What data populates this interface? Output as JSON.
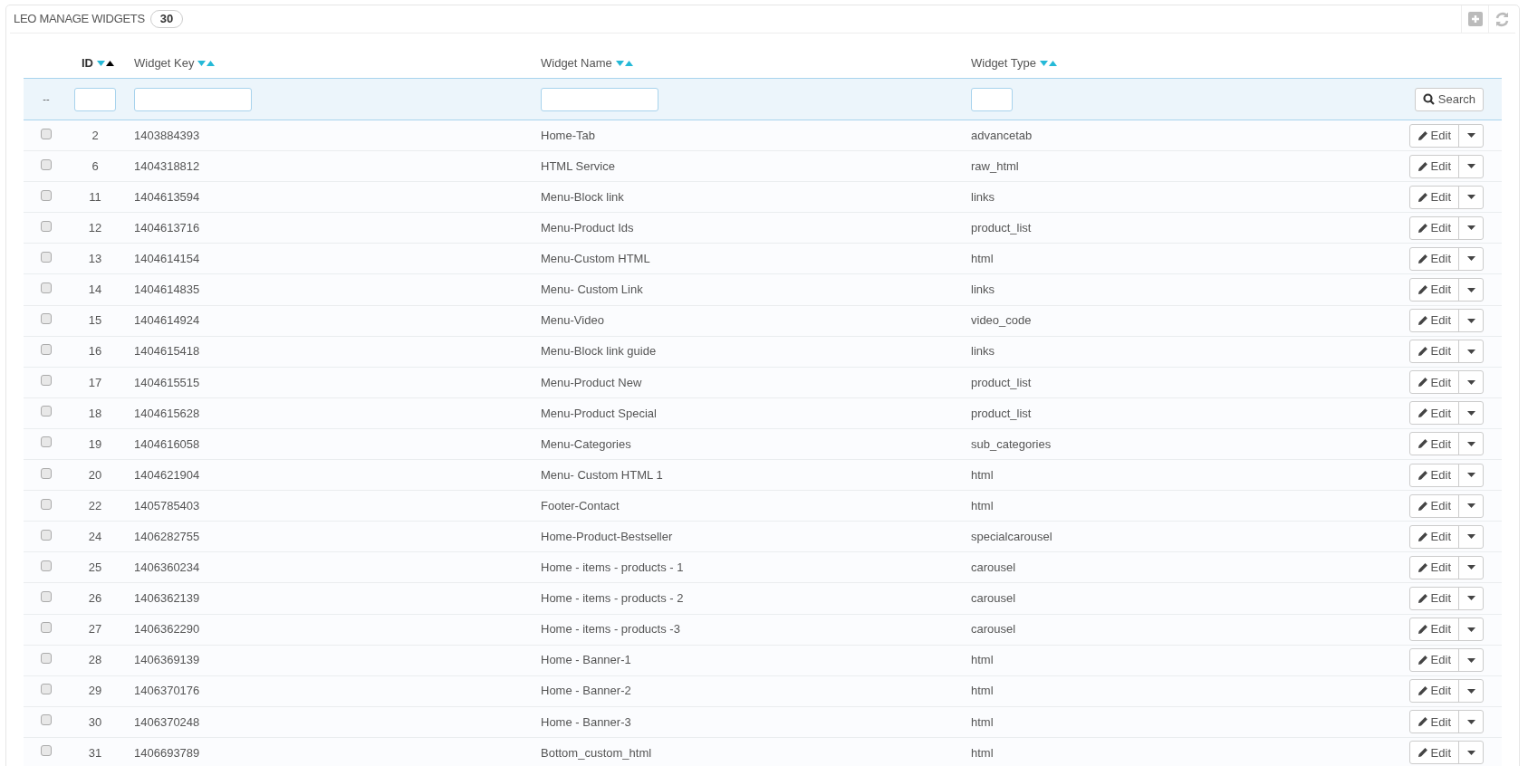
{
  "panel": {
    "title": "LEO MANAGE WIDGETS",
    "count": "30"
  },
  "table": {
    "columns": [
      {
        "label": "ID",
        "sorted_ascending": true
      },
      {
        "label": "Widget Key",
        "sorted_ascending": false
      },
      {
        "label": "Widget Name",
        "sorted_ascending": false
      },
      {
        "label": "Widget Type",
        "sorted_ascending": false
      }
    ],
    "filter_row": {
      "bulk_label": "--",
      "search_button": "Search"
    },
    "rows": [
      {
        "checked": false,
        "id": "2",
        "key": "1403884393",
        "name": "Home-Tab",
        "type": "advancetab",
        "edit": "Edit"
      },
      {
        "checked": false,
        "id": "6",
        "key": "1404318812",
        "name": "HTML Service",
        "type": "raw_html",
        "edit": "Edit"
      },
      {
        "checked": false,
        "id": "11",
        "key": "1404613594",
        "name": "Menu-Block link",
        "type": "links",
        "edit": "Edit"
      },
      {
        "checked": false,
        "id": "12",
        "key": "1404613716",
        "name": "Menu-Product Ids",
        "type": "product_list",
        "edit": "Edit"
      },
      {
        "checked": false,
        "id": "13",
        "key": "1404614154",
        "name": "Menu-Custom HTML",
        "type": "html",
        "edit": "Edit"
      },
      {
        "checked": false,
        "id": "14",
        "key": "1404614835",
        "name": "Menu- Custom Link",
        "type": "links",
        "edit": "Edit"
      },
      {
        "checked": false,
        "id": "15",
        "key": "1404614924",
        "name": "Menu-Video",
        "type": "video_code",
        "edit": "Edit"
      },
      {
        "checked": false,
        "id": "16",
        "key": "1404615418",
        "name": "Menu-Block link guide",
        "type": "links",
        "edit": "Edit"
      },
      {
        "checked": false,
        "id": "17",
        "key": "1404615515",
        "name": "Menu-Product New",
        "type": "product_list",
        "edit": "Edit"
      },
      {
        "checked": false,
        "id": "18",
        "key": "1404615628",
        "name": "Menu-Product Special",
        "type": "product_list",
        "edit": "Edit"
      },
      {
        "checked": false,
        "id": "19",
        "key": "1404616058",
        "name": "Menu-Categories",
        "type": "sub_categories",
        "edit": "Edit"
      },
      {
        "checked": false,
        "id": "20",
        "key": "1404621904",
        "name": "Menu- Custom HTML 1",
        "type": "html",
        "edit": "Edit"
      },
      {
        "checked": false,
        "id": "22",
        "key": "1405785403",
        "name": "Footer-Contact",
        "type": "html",
        "edit": "Edit"
      },
      {
        "checked": false,
        "id": "24",
        "key": "1406282755",
        "name": "Home-Product-Bestseller",
        "type": "specialcarousel",
        "edit": "Edit"
      },
      {
        "checked": false,
        "id": "25",
        "key": "1406360234",
        "name": "Home - items - products - 1",
        "type": "carousel",
        "edit": "Edit"
      },
      {
        "checked": false,
        "id": "26",
        "key": "1406362139",
        "name": "Home - items - products - 2",
        "type": "carousel",
        "edit": "Edit"
      },
      {
        "checked": false,
        "id": "27",
        "key": "1406362290",
        "name": "Home - items - products -3",
        "type": "carousel",
        "edit": "Edit"
      },
      {
        "checked": false,
        "id": "28",
        "key": "1406369139",
        "name": "Home - Banner-1",
        "type": "html",
        "edit": "Edit"
      },
      {
        "checked": false,
        "id": "29",
        "key": "1406370176",
        "name": "Home - Banner-2",
        "type": "html",
        "edit": "Edit"
      },
      {
        "checked": false,
        "id": "30",
        "key": "1406370248",
        "name": "Home - Banner-3",
        "type": "html",
        "edit": "Edit"
      },
      {
        "checked": false,
        "id": "31",
        "key": "1406693789",
        "name": "Bottom_custom_html",
        "type": "html",
        "edit": "Edit"
      }
    ]
  }
}
